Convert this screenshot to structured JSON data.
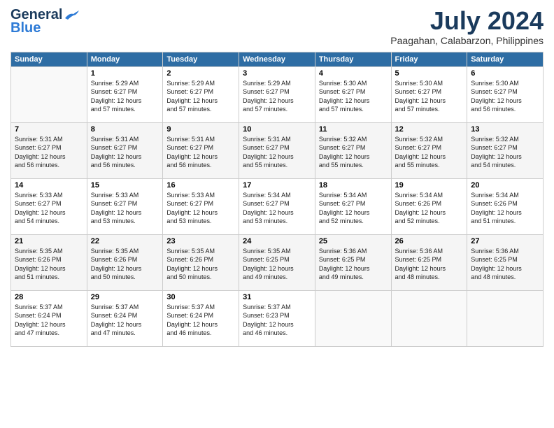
{
  "logo": {
    "line1": "General",
    "line2": "Blue"
  },
  "title": "July 2024",
  "location": "Paagahan, Calabarzon, Philippines",
  "headers": [
    "Sunday",
    "Monday",
    "Tuesday",
    "Wednesday",
    "Thursday",
    "Friday",
    "Saturday"
  ],
  "weeks": [
    [
      {
        "day": "",
        "content": ""
      },
      {
        "day": "1",
        "content": "Sunrise: 5:29 AM\nSunset: 6:27 PM\nDaylight: 12 hours\nand 57 minutes."
      },
      {
        "day": "2",
        "content": "Sunrise: 5:29 AM\nSunset: 6:27 PM\nDaylight: 12 hours\nand 57 minutes."
      },
      {
        "day": "3",
        "content": "Sunrise: 5:29 AM\nSunset: 6:27 PM\nDaylight: 12 hours\nand 57 minutes."
      },
      {
        "day": "4",
        "content": "Sunrise: 5:30 AM\nSunset: 6:27 PM\nDaylight: 12 hours\nand 57 minutes."
      },
      {
        "day": "5",
        "content": "Sunrise: 5:30 AM\nSunset: 6:27 PM\nDaylight: 12 hours\nand 57 minutes."
      },
      {
        "day": "6",
        "content": "Sunrise: 5:30 AM\nSunset: 6:27 PM\nDaylight: 12 hours\nand 56 minutes."
      }
    ],
    [
      {
        "day": "7",
        "content": "Sunrise: 5:31 AM\nSunset: 6:27 PM\nDaylight: 12 hours\nand 56 minutes."
      },
      {
        "day": "8",
        "content": "Sunrise: 5:31 AM\nSunset: 6:27 PM\nDaylight: 12 hours\nand 56 minutes."
      },
      {
        "day": "9",
        "content": "Sunrise: 5:31 AM\nSunset: 6:27 PM\nDaylight: 12 hours\nand 56 minutes."
      },
      {
        "day": "10",
        "content": "Sunrise: 5:31 AM\nSunset: 6:27 PM\nDaylight: 12 hours\nand 55 minutes."
      },
      {
        "day": "11",
        "content": "Sunrise: 5:32 AM\nSunset: 6:27 PM\nDaylight: 12 hours\nand 55 minutes."
      },
      {
        "day": "12",
        "content": "Sunrise: 5:32 AM\nSunset: 6:27 PM\nDaylight: 12 hours\nand 55 minutes."
      },
      {
        "day": "13",
        "content": "Sunrise: 5:32 AM\nSunset: 6:27 PM\nDaylight: 12 hours\nand 54 minutes."
      }
    ],
    [
      {
        "day": "14",
        "content": "Sunrise: 5:33 AM\nSunset: 6:27 PM\nDaylight: 12 hours\nand 54 minutes."
      },
      {
        "day": "15",
        "content": "Sunrise: 5:33 AM\nSunset: 6:27 PM\nDaylight: 12 hours\nand 53 minutes."
      },
      {
        "day": "16",
        "content": "Sunrise: 5:33 AM\nSunset: 6:27 PM\nDaylight: 12 hours\nand 53 minutes."
      },
      {
        "day": "17",
        "content": "Sunrise: 5:34 AM\nSunset: 6:27 PM\nDaylight: 12 hours\nand 53 minutes."
      },
      {
        "day": "18",
        "content": "Sunrise: 5:34 AM\nSunset: 6:27 PM\nDaylight: 12 hours\nand 52 minutes."
      },
      {
        "day": "19",
        "content": "Sunrise: 5:34 AM\nSunset: 6:26 PM\nDaylight: 12 hours\nand 52 minutes."
      },
      {
        "day": "20",
        "content": "Sunrise: 5:34 AM\nSunset: 6:26 PM\nDaylight: 12 hours\nand 51 minutes."
      }
    ],
    [
      {
        "day": "21",
        "content": "Sunrise: 5:35 AM\nSunset: 6:26 PM\nDaylight: 12 hours\nand 51 minutes."
      },
      {
        "day": "22",
        "content": "Sunrise: 5:35 AM\nSunset: 6:26 PM\nDaylight: 12 hours\nand 50 minutes."
      },
      {
        "day": "23",
        "content": "Sunrise: 5:35 AM\nSunset: 6:26 PM\nDaylight: 12 hours\nand 50 minutes."
      },
      {
        "day": "24",
        "content": "Sunrise: 5:35 AM\nSunset: 6:25 PM\nDaylight: 12 hours\nand 49 minutes."
      },
      {
        "day": "25",
        "content": "Sunrise: 5:36 AM\nSunset: 6:25 PM\nDaylight: 12 hours\nand 49 minutes."
      },
      {
        "day": "26",
        "content": "Sunrise: 5:36 AM\nSunset: 6:25 PM\nDaylight: 12 hours\nand 48 minutes."
      },
      {
        "day": "27",
        "content": "Sunrise: 5:36 AM\nSunset: 6:25 PM\nDaylight: 12 hours\nand 48 minutes."
      }
    ],
    [
      {
        "day": "28",
        "content": "Sunrise: 5:37 AM\nSunset: 6:24 PM\nDaylight: 12 hours\nand 47 minutes."
      },
      {
        "day": "29",
        "content": "Sunrise: 5:37 AM\nSunset: 6:24 PM\nDaylight: 12 hours\nand 47 minutes."
      },
      {
        "day": "30",
        "content": "Sunrise: 5:37 AM\nSunset: 6:24 PM\nDaylight: 12 hours\nand 46 minutes."
      },
      {
        "day": "31",
        "content": "Sunrise: 5:37 AM\nSunset: 6:23 PM\nDaylight: 12 hours\nand 46 minutes."
      },
      {
        "day": "",
        "content": ""
      },
      {
        "day": "",
        "content": ""
      },
      {
        "day": "",
        "content": ""
      }
    ]
  ]
}
